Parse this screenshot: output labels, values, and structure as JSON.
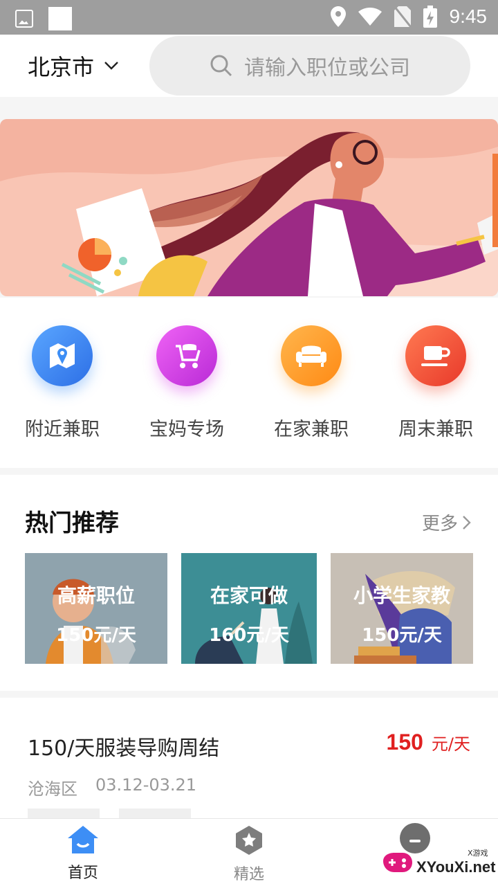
{
  "status_bar": {
    "time": "9:45"
  },
  "header": {
    "city": "北京市",
    "search_placeholder": "请输入职位或公司"
  },
  "categories": [
    {
      "label": "附近兼职",
      "icon": "map-icon",
      "color": "#3d8ef5"
    },
    {
      "label": "宝妈专场",
      "icon": "stroller-icon",
      "color": "#d63be8"
    },
    {
      "label": "在家兼职",
      "icon": "sofa-icon",
      "color": "#ff9a22"
    },
    {
      "label": "周末兼职",
      "icon": "coffee-icon",
      "color": "#f2553a"
    }
  ],
  "hot": {
    "title": "热门推荐",
    "more": "更多",
    "cards": [
      {
        "title": "高薪职位",
        "price": "150元/天"
      },
      {
        "title": "在家可做",
        "price": "160元/天"
      },
      {
        "title": "小学生家教",
        "price": "150元/天"
      }
    ]
  },
  "job": {
    "title": "150/天服装导购周结",
    "pay_amount": "150",
    "pay_unit": "元/天",
    "district": "沧海区",
    "dates": "03.12-03.21"
  },
  "tabs": [
    {
      "label": "首页",
      "icon": "home-icon",
      "active": true
    },
    {
      "label": "精选",
      "icon": "star-badge-icon",
      "active": false
    }
  ],
  "watermark": {
    "text": "XYouXi.net",
    "small": "X游戏"
  },
  "colors": {
    "accent": "#3d8ef5",
    "price": "#e02020"
  }
}
